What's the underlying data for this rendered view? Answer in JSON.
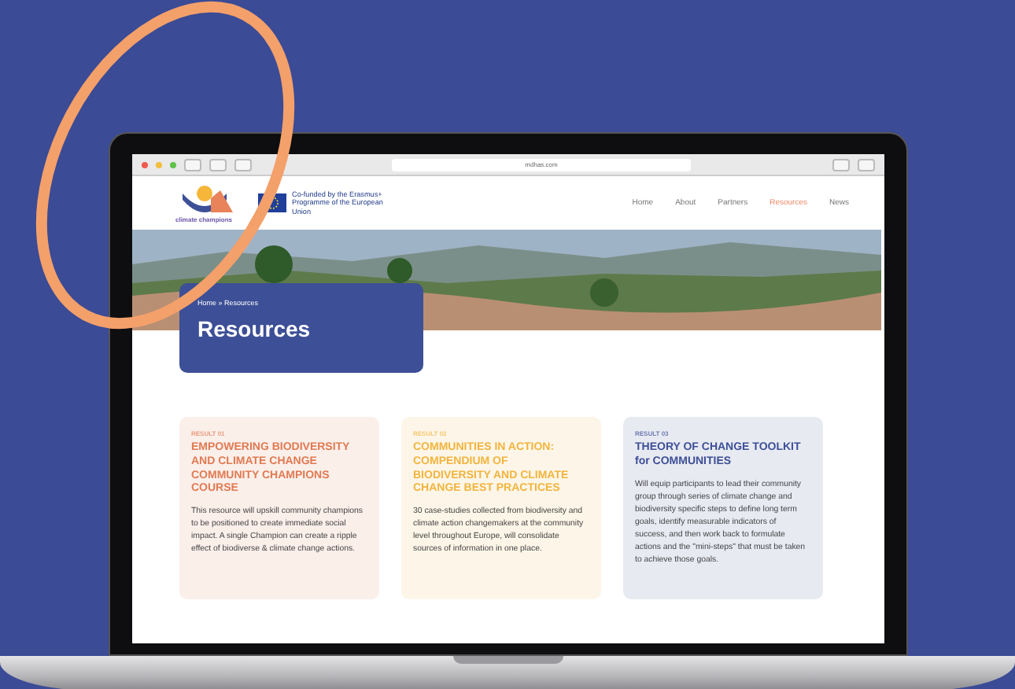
{
  "browser": {
    "url": "mdhas.com"
  },
  "header": {
    "logo_text": "climate champions",
    "funding_note": "Co-funded by the Erasmus+ Programme of the European Union",
    "nav": [
      {
        "label": "Home",
        "selected": false
      },
      {
        "label": "About",
        "selected": false
      },
      {
        "label": "Partners",
        "selected": false
      },
      {
        "label": "Resources",
        "selected": true
      },
      {
        "label": "News",
        "selected": false
      }
    ]
  },
  "page_title": {
    "breadcrumb": "Home » Resources",
    "title": "Resources"
  },
  "results": [
    {
      "label": "RESULT 01",
      "title": "EMPOWERING BIODIVERSITY AND CLIMATE CHANGE COMMUNITY CHAMPIONS COURSE",
      "text": "This resource will upskill community champions to be positioned to create immediate social impact. A single Champion can create a ripple effect of biodiverse & climate change actions.",
      "color": "#e07a52"
    },
    {
      "label": "RESULT 02",
      "title": "COMMUNITIES IN ACTION: COMPENDIUM OF BIODIVERSITY AND CLIMATE CHANGE BEST PRACTICES",
      "text": "30 case-studies collected from biodiversity and climate action changemakers at the community level throughout Europe, will consolidate sources of information in one place.",
      "color": "#f2b43e"
    },
    {
      "label": "RESULT 03",
      "title": "THEORY OF CHANGE TOOLKIT for COMMUNITIES",
      "text": "Will equip participants to lead their community group through series of climate change and biodiversity specific steps to define long term goals, identify measurable indicators of success, and then work back to formulate actions and the \"mini-steps\" that must be taken to achieve those goals.",
      "color": "#3d4f96"
    }
  ]
}
